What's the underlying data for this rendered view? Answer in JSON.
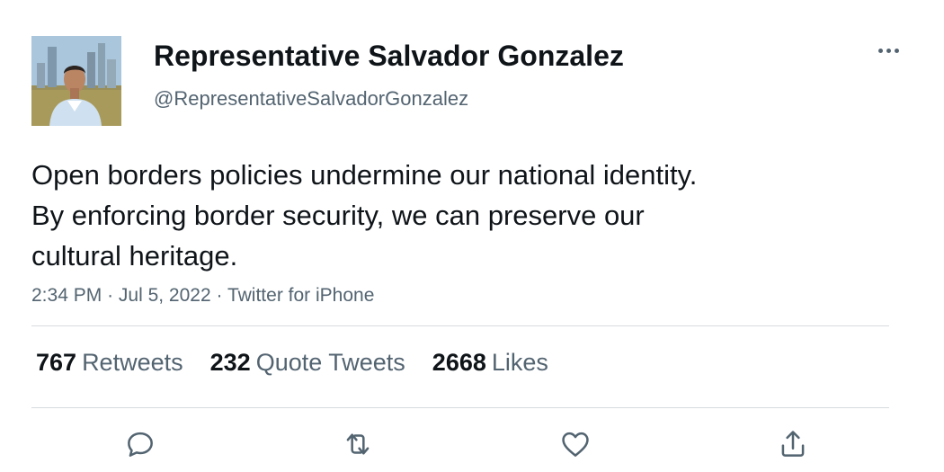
{
  "author": {
    "display_name": "Representative Salvador Gonzalez",
    "handle": "@RepresentativeSalvadorGonzalez"
  },
  "tweet": {
    "lines": [
      "Open borders policies undermine our national identity.",
      "By enforcing border security, we can preserve our",
      "cultural heritage."
    ],
    "time": "2:34 PM",
    "date": "Jul 5, 2022",
    "source": "Twitter for iPhone",
    "separator": "·"
  },
  "stats": {
    "retweets": {
      "count": "767",
      "label": "Retweets"
    },
    "quotes": {
      "count": "232",
      "label": "Quote Tweets"
    },
    "likes": {
      "count": "2668",
      "label": "Likes"
    }
  },
  "actions": {
    "reply": "reply-icon",
    "retweet": "retweet-icon",
    "like": "heart-icon",
    "share": "share-icon"
  },
  "colors": {
    "text_primary": "#0f1419",
    "text_secondary": "#536471",
    "divider": "#d7dbdf"
  }
}
